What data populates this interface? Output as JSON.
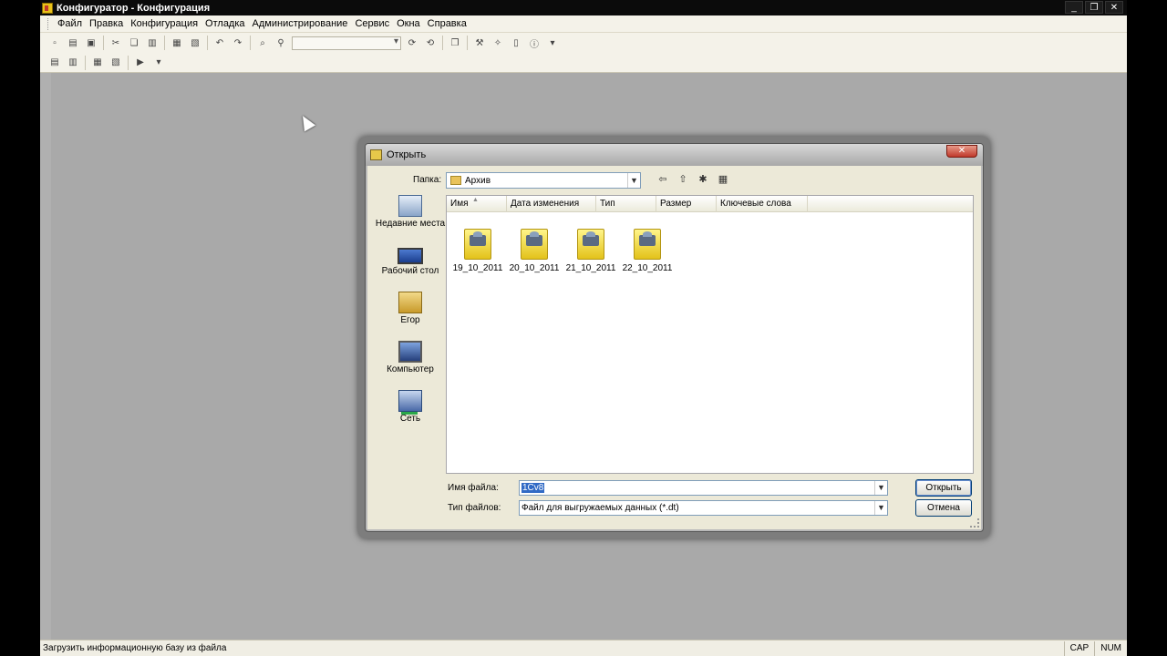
{
  "window": {
    "title": "Конфигуратор - Конфигурация",
    "controls": [
      "_",
      "❐",
      "✕"
    ]
  },
  "menubar": {
    "items": [
      "Файл",
      "Правка",
      "Конфигурация",
      "Отладка",
      "Администрирование",
      "Сервис",
      "Окна",
      "Справка"
    ]
  },
  "statusbar": {
    "text": "Загрузить информационную базу из файла",
    "indicators": [
      "CAP",
      "NUM"
    ]
  },
  "dialog": {
    "title": "Открыть",
    "close_label": "✕",
    "folder_label": "Папка:",
    "folder_value": "Архив",
    "columns": [
      "Имя",
      "Дата изменения",
      "Тип",
      "Размер",
      "Ключевые слова"
    ],
    "places": [
      {
        "label": "Недавние места",
        "icon": "recent-places-icon"
      },
      {
        "label": "Рабочий стол",
        "icon": "desktop-icon"
      },
      {
        "label": "Егор",
        "icon": "user-folder-icon"
      },
      {
        "label": "Компьютер",
        "icon": "computer-icon"
      },
      {
        "label": "Сеть",
        "icon": "network-icon"
      }
    ],
    "files": [
      {
        "name": "19_10_2011"
      },
      {
        "name": "20_10_2011"
      },
      {
        "name": "21_10_2011"
      },
      {
        "name": "22_10_2011"
      }
    ],
    "filename_label": "Имя файла:",
    "filename_value": "1Cv8",
    "filetype_label": "Тип файлов:",
    "filetype_value": "Файл для выгружаемых данных (*.dt)",
    "open_button": "Открыть",
    "cancel_button": "Отмена"
  }
}
